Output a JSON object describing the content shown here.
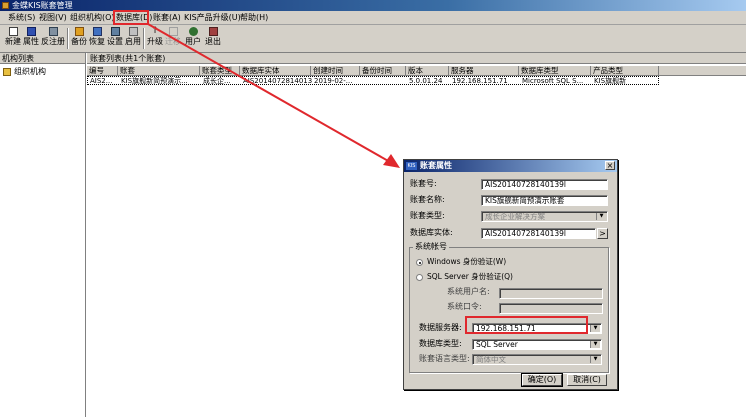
{
  "window": {
    "title": "金蝶KIS账套管理"
  },
  "menu": [
    {
      "label": "系统(S)"
    },
    {
      "label": "视图(V)"
    },
    {
      "label": "组织机构(O)"
    },
    {
      "label": "数据库(D)"
    },
    {
      "label": "账套(A)"
    },
    {
      "label": "KIS产品升级(U)"
    },
    {
      "label": "帮助(H)"
    }
  ],
  "toolbar": [
    {
      "label": "新建",
      "icon": "new-icon"
    },
    {
      "label": "属性",
      "icon": "properties-icon"
    },
    {
      "label": "反注册",
      "icon": "unregister-icon"
    },
    {
      "label": "备份",
      "icon": "backup-icon"
    },
    {
      "label": "恢复",
      "icon": "restore-icon"
    },
    {
      "label": "设置",
      "icon": "settings-icon"
    },
    {
      "label": "启用",
      "icon": "enable-icon"
    },
    {
      "label": "升级",
      "icon": "upgrade-icon"
    },
    {
      "label": "迁移",
      "icon": "migrate-icon"
    },
    {
      "label": "用户",
      "icon": "user-icon"
    },
    {
      "label": "退出",
      "icon": "exit-icon"
    }
  ],
  "left_panel": {
    "header": "机构列表",
    "tree_node": "组织机构"
  },
  "right_panel": {
    "header": "账套列表(共1个账套)",
    "columns": [
      "编号",
      "账套",
      "账套类型",
      "数据库实体",
      "创建时间",
      "备份时间",
      "版本",
      "服务器",
      "数据库类型",
      "产品类型"
    ],
    "rows": [
      [
        "AIS2...",
        "KIS旗舰新简预演示...",
        "成长企...",
        "AIS20140728140139l",
        "2019-02-...",
        "",
        "5.0.01.24",
        "192.168.151.71",
        "Microsoft SQL S...",
        "KIS旗舰新"
      ]
    ]
  },
  "dialog": {
    "title": "账套属性",
    "account_no_label": "账套号:",
    "account_no_value": "AIS20140728140139l",
    "account_name_label": "账套名称:",
    "account_name_value": "KIS旗舰新简预演示账套",
    "account_type_label": "账套类型:",
    "account_type_value": "成长企业解决方案",
    "db_entity_label": "数据库实体:",
    "db_entity_value": "AIS20140728140139l",
    "sys_account_group": "系统帐号",
    "windows_auth": "Windows 身份验证(W)",
    "sql_auth": "SQL Server 身份验证(Q)",
    "sys_user_label": "系统用户名:",
    "sys_pwd_label": "系统口令:",
    "db_server_label": "数据服务器:",
    "db_server_value": "192.168.151.71",
    "db_type_label": "数据库类型:",
    "db_type_value": "SQL Server",
    "lang_label": "账套语言类型:",
    "lang_value": "简体中文",
    "ok_label": "确定(O)",
    "cancel_label": "取消(C)",
    "close_glyph": "×",
    "browse_glyph": ">"
  },
  "colors": {
    "highlight": "#e0282d",
    "titlebar": "#0a246a",
    "chrome": "#d4d0c8"
  }
}
